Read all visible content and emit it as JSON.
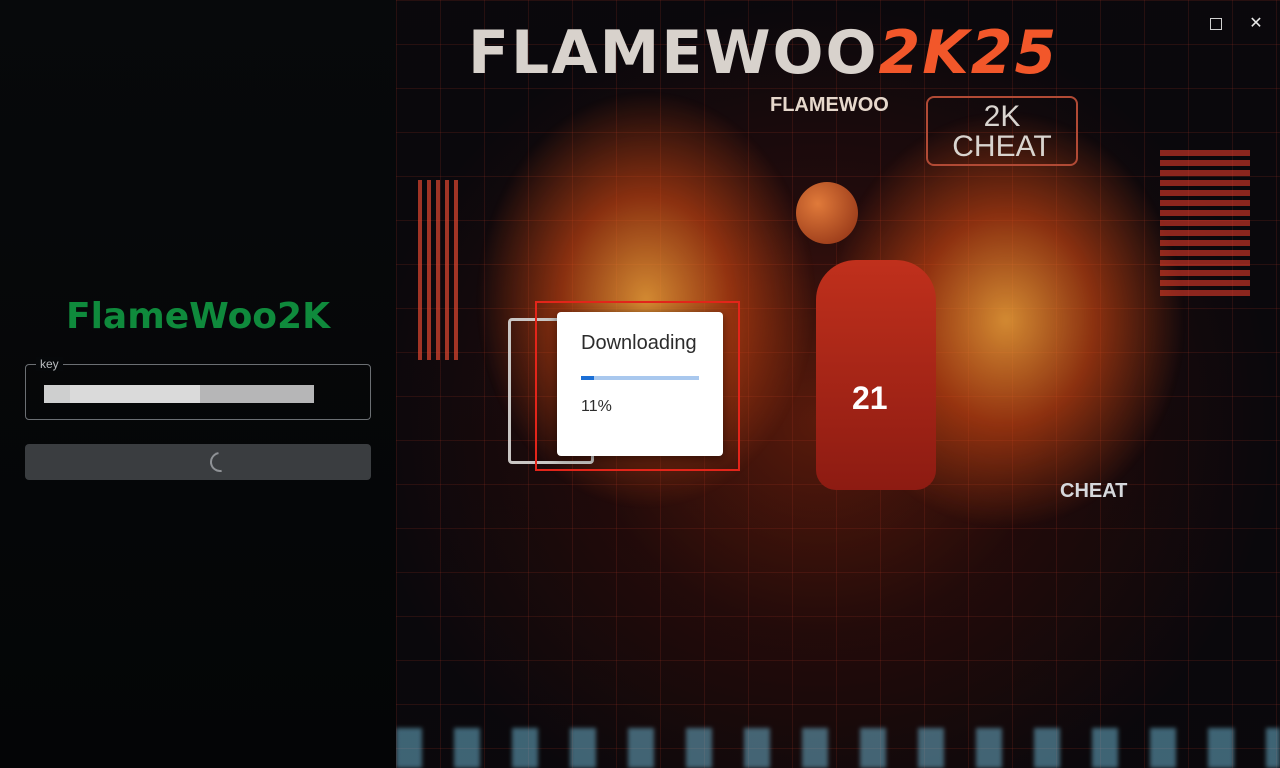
{
  "app": {
    "title": "FlameWoo2K"
  },
  "login": {
    "key_label": "key",
    "key_value": "",
    "submit_state": "loading"
  },
  "poster": {
    "title_main": "FLAMEWOO",
    "title_accent": "2K25",
    "subtitle": "FLAMEWOO",
    "badge_line1": "2K",
    "badge_line2": "CHEAT",
    "small_badge": "CHEAT",
    "jersey_number": "21"
  },
  "window_controls": {
    "maximize": "maximize-icon",
    "close": "✕"
  },
  "modal": {
    "title": "Downloading",
    "progress": 0.11,
    "percent_text": "11%"
  },
  "colors": {
    "accent_green": "#0f8a3c",
    "progress_fill": "#1b6fd6",
    "progress_track": "#a9c8ee",
    "highlight_red": "#e3251a"
  }
}
